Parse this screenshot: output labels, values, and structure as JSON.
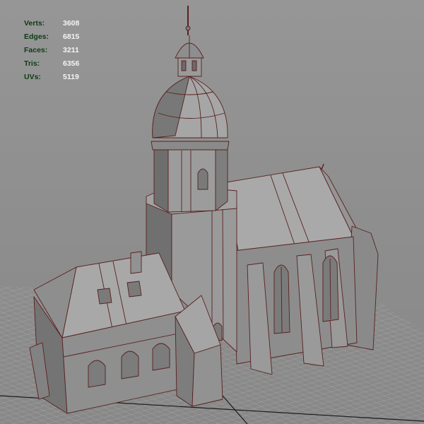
{
  "viewport": {
    "name": "3D perspective viewport",
    "grid": true,
    "model": "church with octagonal bell tower",
    "colors": {
      "background": "#8f8f8f",
      "grid_line": "#b4b4b4",
      "grid_axis": "#1a1a1a",
      "wireframe": "#5a2020",
      "face_light": "#a7a7a7",
      "face_mid": "#8c8c8c",
      "face_dark": "#6e6e6e"
    }
  },
  "hud": {
    "stats": [
      {
        "label": "Verts:",
        "value": "3608"
      },
      {
        "label": "Edges:",
        "value": "6815"
      },
      {
        "label": "Faces:",
        "value": "3211"
      },
      {
        "label": "Tris:",
        "value": "6356"
      },
      {
        "label": "UVs:",
        "value": "5119"
      }
    ]
  }
}
